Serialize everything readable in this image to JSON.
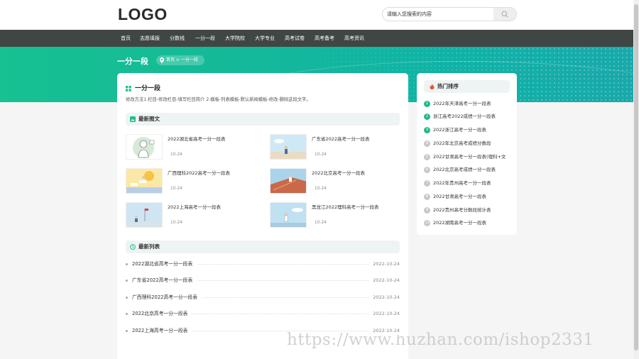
{
  "header": {
    "logo": "LOGO",
    "search_placeholder": "请输入您搜索的内容"
  },
  "nav": [
    "首页",
    "志愿填报",
    "分数线",
    "一分一段",
    "大学院校",
    "大学专业",
    "高考试卷",
    "高考备考",
    "高考资讯"
  ],
  "banner": {
    "title": "一分一段",
    "breadcrumb": "首页 > 一分一段"
  },
  "main": {
    "title": "一分一段",
    "description": "修改方法1.栏目-修改栏目-填写栏目简介 2.模板-列表模板-默认新闻模板-修改-删除这段文字。",
    "images_heading": "最新图文",
    "images": [
      {
        "title": "2022湖北省高考一分一段表",
        "date": "10-24"
      },
      {
        "title": "广东省2022高考一分一段表",
        "date": "10-24"
      },
      {
        "title": "广西理科2022高考一分一段表",
        "date": "10-24"
      },
      {
        "title": "2022北京高考一分一段表",
        "date": "10-24"
      },
      {
        "title": "2022上海高考一分一段表",
        "date": "10-24"
      },
      {
        "title": "黑龙江2022理科高考一分一段表",
        "date": "10-24"
      }
    ],
    "list_heading": "最新列表",
    "list": [
      {
        "title": "2022湖北省高考一分一段表",
        "date": "2022-10-24"
      },
      {
        "title": "广东省2022高考一分一段表",
        "date": "2022-10-24"
      },
      {
        "title": "广西理科2022高考一分一段表",
        "date": "2022-10-24"
      },
      {
        "title": "2022北京高考一分一段表",
        "date": "2022-10-24"
      },
      {
        "title": "2022上海高考一分一段表",
        "date": "2022-10-24"
      }
    ]
  },
  "sidebar": {
    "title": "热门排序",
    "items": [
      {
        "rank": "1",
        "title": "2022年天津高考一分一段表"
      },
      {
        "rank": "2",
        "title": "浙江高考2022成绩一分一段表"
      },
      {
        "rank": "3",
        "title": "2022浙江高考一分一段表"
      },
      {
        "rank": "4",
        "title": "2022年北京高考成绩分数段"
      },
      {
        "rank": "5",
        "title": "2022甘肃高考一分一段表(理科+文"
      },
      {
        "rank": "6",
        "title": "2022北京高考成绩一分一段表"
      },
      {
        "rank": "7",
        "title": "2022年贵州高考一分一段表"
      },
      {
        "rank": "8",
        "title": "2022甘肃高考一分一段表"
      },
      {
        "rank": "9",
        "title": "2022贵州高考分数段统计表"
      },
      {
        "rank": "10",
        "title": "2022湖南高考一分一段表"
      }
    ]
  },
  "watermark": "https://www.huzhan.com/ishop2331",
  "colors": {
    "accent": "#1fbf8f",
    "nav_bg": "#3f4644",
    "rank_top": "#20b98a",
    "rank_rest": "#c8c8c8"
  }
}
